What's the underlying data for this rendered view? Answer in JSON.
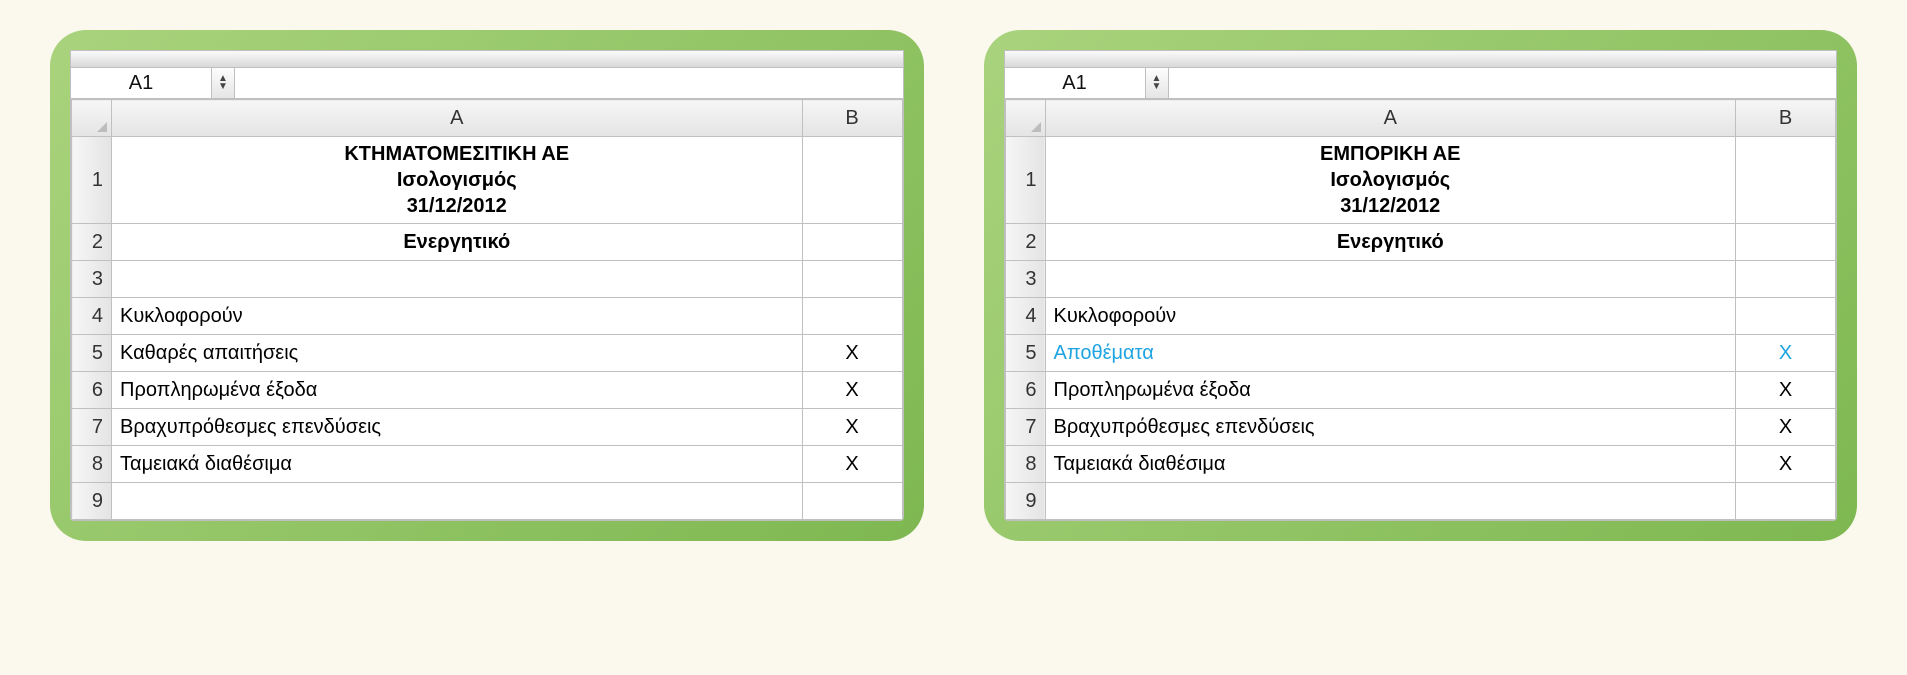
{
  "shared": {
    "nameBoxValue": "A1",
    "colA": "A",
    "colB": "B",
    "rowNums": [
      "1",
      "2",
      "3",
      "4",
      "5",
      "6",
      "7",
      "8",
      "9"
    ]
  },
  "left": {
    "titleLine1": "ΚΤΗΜΑΤΟΜΕΣΙΤΙΚΗ ΑΕ",
    "titleLine2": "Ισολογισμός",
    "titleLine3": "31/12/2012",
    "header": "Ενεργητικό",
    "groupLabel": "Κυκλοφορούν",
    "items": [
      {
        "label": "Καθαρές απαιτήσεις",
        "value": "X",
        "hl": false
      },
      {
        "label": "Προπληρωμένα έξοδα",
        "value": "X",
        "hl": false
      },
      {
        "label": "Βραχυπρόθεσμες επενδύσεις",
        "value": "X",
        "hl": false
      },
      {
        "label": "Ταμειακά διαθέσιμα",
        "value": "X",
        "hl": false
      }
    ]
  },
  "right": {
    "titleLine1": "ΕΜΠΟΡΙΚΗ ΑΕ",
    "titleLine2": "Ισολογισμός",
    "titleLine3": "31/12/2012",
    "header": "Ενεργητικό",
    "groupLabel": "Κυκλοφορούν",
    "items": [
      {
        "label": "Αποθέματα",
        "value": "X",
        "hl": true
      },
      {
        "label": "Προπληρωμένα έξοδα",
        "value": "X",
        "hl": false
      },
      {
        "label": "Βραχυπρόθεσμες επενδύσεις",
        "value": "X",
        "hl": false
      },
      {
        "label": "Ταμειακά διαθέσιμα",
        "value": "X",
        "hl": false
      }
    ]
  }
}
